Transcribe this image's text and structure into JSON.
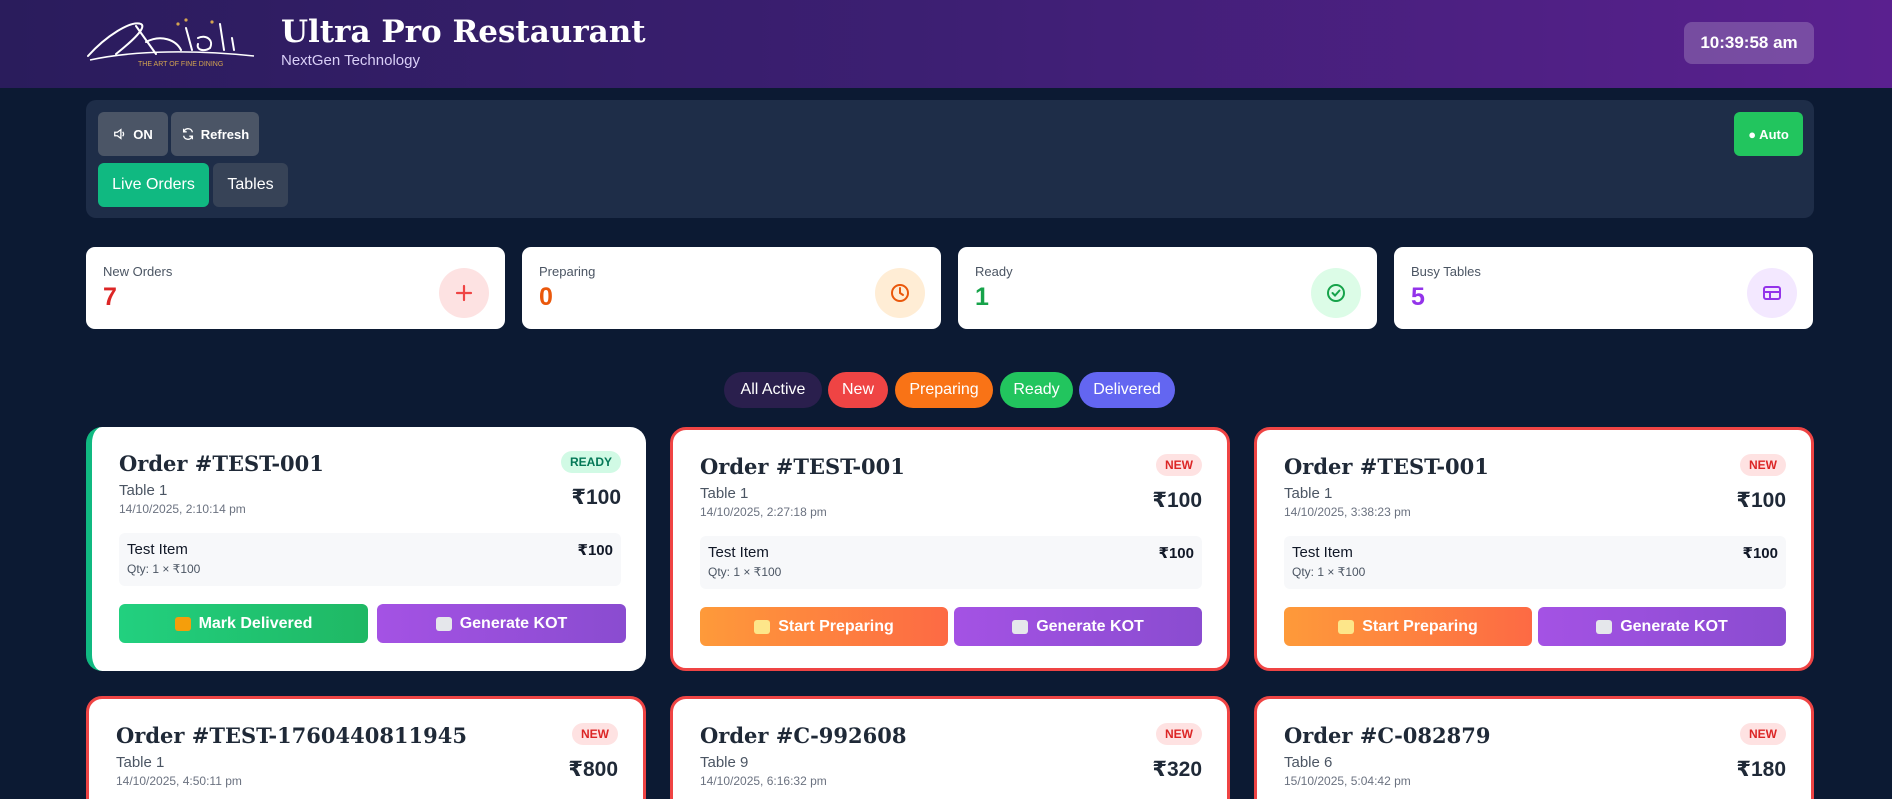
{
  "header": {
    "logo_script": "Aambli",
    "logo_tagline": "THE ART OF FINE DINING",
    "title": "Ultra Pro Restaurant",
    "subtitle": "NextGen Technology",
    "clock": "10:39:58 am"
  },
  "toolbar": {
    "sound_label": "ON",
    "refresh_label": "Refresh",
    "auto_label": "● Auto",
    "tabs": [
      {
        "label": "Live Orders",
        "active": true
      },
      {
        "label": "Tables",
        "active": false
      }
    ]
  },
  "stats": [
    {
      "label": "New Orders",
      "value": "7",
      "color": "#dc2626",
      "icon": "plus-icon"
    },
    {
      "label": "Preparing",
      "value": "0",
      "color": "#ea580c",
      "icon": "clock-icon"
    },
    {
      "label": "Ready",
      "value": "1",
      "color": "#16a34a",
      "icon": "check-circle-icon"
    },
    {
      "label": "Busy Tables",
      "value": "5",
      "color": "#9333ea",
      "icon": "table-icon"
    }
  ],
  "filters": [
    {
      "label": "All Active",
      "color": "#2a1f4d"
    },
    {
      "label": "New",
      "color": "#ef4444"
    },
    {
      "label": "Preparing",
      "color": "#f97316"
    },
    {
      "label": "Ready",
      "color": "#22c55e"
    },
    {
      "label": "Delivered",
      "color": "#6366f1"
    }
  ],
  "orders": [
    {
      "title": "Order #TEST-001",
      "table": "Table 1",
      "date": "14/10/2025, 2:10:14 pm",
      "status": "READY",
      "total": "₹100",
      "item_name": "Test Item",
      "item_qty": "Qty: 1 × ₹100",
      "item_price": "₹100",
      "primary_action": "Mark Delivered",
      "secondary_action": "Generate KOT"
    },
    {
      "title": "Order #TEST-001",
      "table": "Table 1",
      "date": "14/10/2025, 2:27:18 pm",
      "status": "NEW",
      "total": "₹100",
      "item_name": "Test Item",
      "item_qty": "Qty: 1 × ₹100",
      "item_price": "₹100",
      "primary_action": "Start Preparing",
      "secondary_action": "Generate KOT"
    },
    {
      "title": "Order #TEST-001",
      "table": "Table 1",
      "date": "14/10/2025, 3:38:23 pm",
      "status": "NEW",
      "total": "₹100",
      "item_name": "Test Item",
      "item_qty": "Qty: 1 × ₹100",
      "item_price": "₹100",
      "primary_action": "Start Preparing",
      "secondary_action": "Generate KOT"
    },
    {
      "title": "Order #TEST-1760440811945",
      "table": "Table 1",
      "date": "14/10/2025, 4:50:11 pm",
      "status": "NEW",
      "total": "₹800"
    },
    {
      "title": "Order #C-992608",
      "table": "Table 9",
      "date": "14/10/2025, 6:16:32 pm",
      "status": "NEW",
      "total": "₹320"
    },
    {
      "title": "Order #C-082879",
      "table": "Table 6",
      "date": "15/10/2025, 5:04:42 pm",
      "status": "NEW",
      "total": "₹180"
    }
  ]
}
